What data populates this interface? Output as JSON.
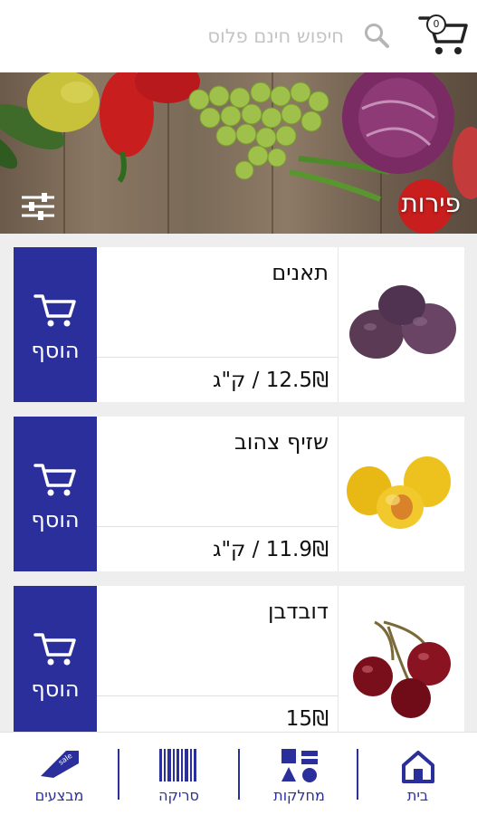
{
  "header": {
    "cart_count": "0",
    "search_placeholder": "חיפוש חינם פלוס"
  },
  "banner": {
    "title": "פירות"
  },
  "products": [
    {
      "name": "תאנים",
      "price": "12.5₪ / ק\"ג",
      "add_label": "הוסף",
      "image": "figs"
    },
    {
      "name": "שזיף צהוב",
      "price": "11.9₪ / ק\"ג",
      "add_label": "הוסף",
      "image": "yellow-plums"
    },
    {
      "name": "דובדבן",
      "price": "15₪",
      "add_label": "הוסף",
      "image": "cherries"
    }
  ],
  "bottom_nav": {
    "home": "בית",
    "categories": "מחלקות",
    "scan": "סריקה",
    "deals": "מבצעים",
    "deals_tag": "sale"
  },
  "colors": {
    "accent": "#2a2f9b",
    "list_background": "#eeeeee"
  }
}
